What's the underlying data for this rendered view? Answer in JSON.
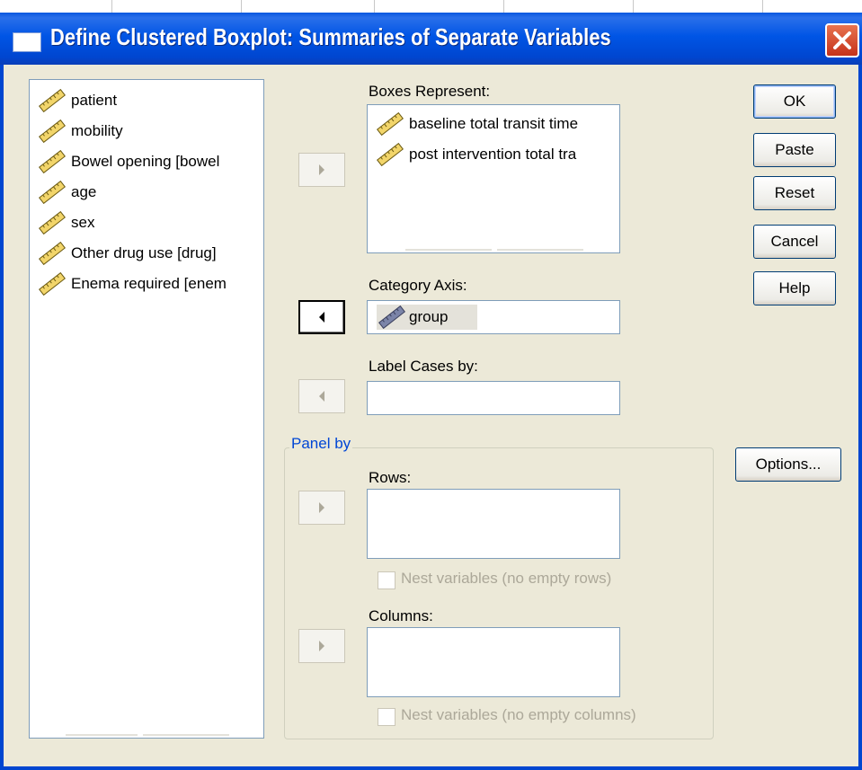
{
  "window": {
    "title": "Define Clustered Boxplot: Summaries of Separate Variables",
    "title_icon": "window-icon",
    "close_icon": "close-icon"
  },
  "variables": {
    "items": [
      {
        "label": "patient",
        "icon": "scale-ruler-icon"
      },
      {
        "label": "mobility",
        "icon": "scale-ruler-icon"
      },
      {
        "label": "Bowel opening [bowel",
        "icon": "scale-ruler-icon"
      },
      {
        "label": "age",
        "icon": "scale-ruler-icon"
      },
      {
        "label": "sex",
        "icon": "scale-ruler-icon"
      },
      {
        "label": "Other drug use [drug]",
        "icon": "scale-ruler-icon"
      },
      {
        "label": "Enema required [enem",
        "icon": "scale-ruler-icon"
      }
    ]
  },
  "boxes": {
    "label": "Boxes Represent:",
    "items": [
      {
        "label": "baseline total transit time",
        "icon": "scale-ruler-icon"
      },
      {
        "label": "post intervention total tra",
        "icon": "scale-ruler-icon"
      }
    ]
  },
  "category_axis": {
    "label": "Category Axis:",
    "value": "group",
    "icon": "scale-ruler-icon"
  },
  "label_cases": {
    "label": "Label Cases by:",
    "value": ""
  },
  "panel": {
    "legend": "Panel by",
    "rows_label": "Rows:",
    "rows_nest": "Nest variables (no empty rows)",
    "columns_label": "Columns:",
    "columns_nest": "Nest variables (no empty columns)"
  },
  "buttons": {
    "ok": "OK",
    "paste": "Paste",
    "reset": "Reset",
    "cancel": "Cancel",
    "help": "Help",
    "options": "Options..."
  },
  "colors": {
    "titlebar": "#0055E5",
    "dialog_bg": "#ECE9D8",
    "group_legend": "#0046D5",
    "disabled_text": "#ACA899"
  }
}
